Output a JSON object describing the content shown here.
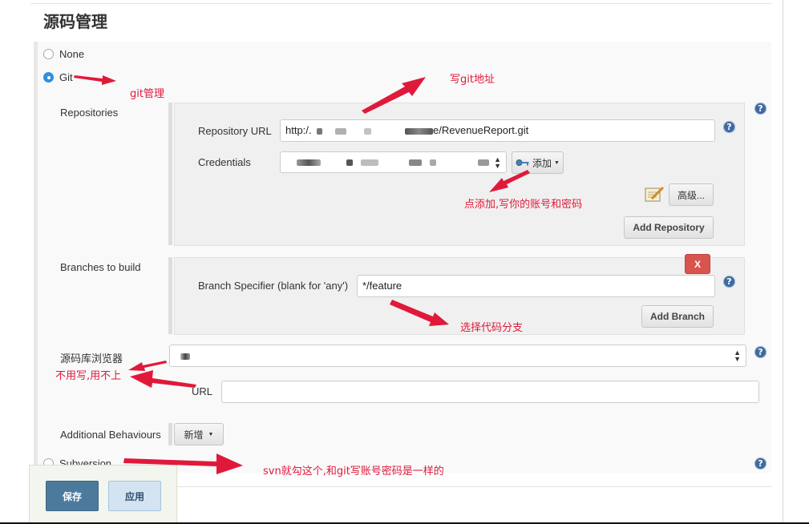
{
  "section": {
    "title": "源码管理"
  },
  "scm_options": {
    "none": "None",
    "git": "Git",
    "subversion": "Subversion",
    "git_selected": true
  },
  "repositories": {
    "label": "Repositories",
    "url_label": "Repository URL",
    "url_prefix": "http:/.",
    "url_suffix": "e/RevenueReport.git",
    "credentials_label": "Credentials",
    "add_button": "添加",
    "advanced_button": "高级...",
    "add_repository_button": "Add Repository"
  },
  "branches": {
    "label": "Branches to build",
    "delete_button": "X",
    "specifier_label": "Branch Specifier (blank for 'any')",
    "specifier_value": "*/feature",
    "add_branch_button": "Add Branch"
  },
  "browser": {
    "label": "源码库浏览器",
    "url_label": "URL",
    "url_value": ""
  },
  "behaviours": {
    "label": "Additional Behaviours",
    "add_button": "新增"
  },
  "footer": {
    "save_button": "保存",
    "apply_button": "应用"
  },
  "help": {
    "glyph": "?"
  },
  "annotations": {
    "git_manage": "git管理",
    "write_git_addr": "写git地址",
    "click_add": "点添加,写你的账号和密码",
    "choose_branch": "选择代码分支",
    "no_need": "不用写,用不上",
    "svn_note": "svn就勾这个,和git写账号密码是一样的"
  },
  "colors": {
    "accent": "#2e8fe0",
    "annotation": "#e0193a",
    "danger": "#d9534f",
    "save": "#4c7a9c",
    "help": "#3e6a9f"
  }
}
